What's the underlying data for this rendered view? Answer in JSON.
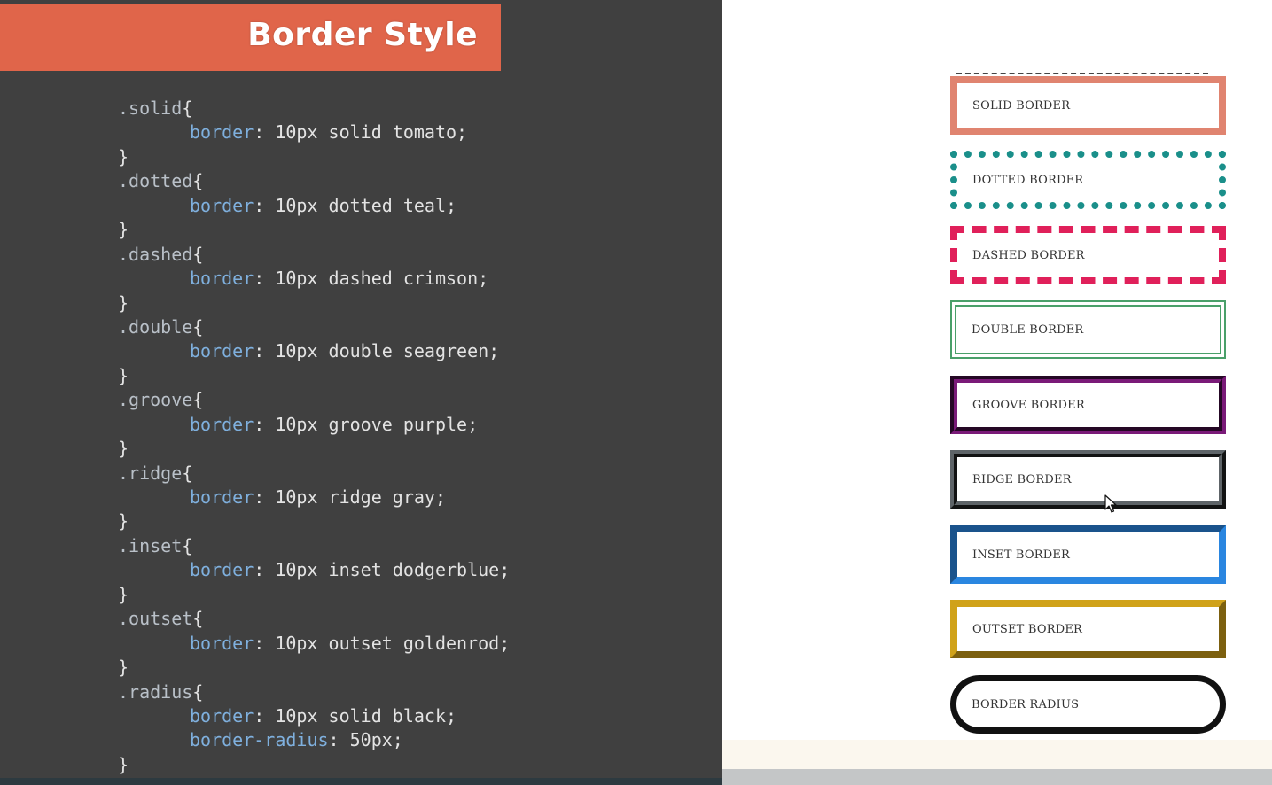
{
  "slide": {
    "title": "Border Style"
  },
  "code": {
    "lines": [
      {
        "selector": ".solid",
        "open": "{"
      },
      {
        "property": "border",
        "value": "10px solid tomato;"
      },
      {
        "close": "}"
      },
      {
        "selector": ".dotted",
        "open": "{"
      },
      {
        "property": "border",
        "value": "10px dotted teal;"
      },
      {
        "close": "}"
      },
      {
        "selector": ".dashed",
        "open": "{"
      },
      {
        "property": "border",
        "value": "10px dashed crimson;"
      },
      {
        "close": "}"
      },
      {
        "selector": ".double",
        "open": "{"
      },
      {
        "property": "border",
        "value": "10px double seagreen;"
      },
      {
        "close": "}"
      },
      {
        "selector": ".groove",
        "open": "{"
      },
      {
        "property": "border",
        "value": "10px groove purple;"
      },
      {
        "close": "}"
      },
      {
        "selector": ".ridge",
        "open": "{"
      },
      {
        "property": "border",
        "value": "10px ridge gray;"
      },
      {
        "close": "}"
      },
      {
        "selector": ".inset",
        "open": "{"
      },
      {
        "property": "border",
        "value": "10px inset dodgerblue;"
      },
      {
        "close": "}"
      },
      {
        "selector": ".outset",
        "open": "{"
      },
      {
        "property": "border",
        "value": "10px outset goldenrod;"
      },
      {
        "close": "}"
      },
      {
        "selector": ".radius",
        "open": "{"
      },
      {
        "property": "border",
        "value": "10px solid black;"
      },
      {
        "property": "border-radius",
        "value": "50px;"
      },
      {
        "close": "}"
      }
    ]
  },
  "preview": {
    "boxes": [
      {
        "id": "solid",
        "label": "SOLID BORDER"
      },
      {
        "id": "dotted",
        "label": "DOTTED BORDER"
      },
      {
        "id": "dashed",
        "label": "DASHED BORDER"
      },
      {
        "id": "double",
        "label": "DOUBLE BORDER"
      },
      {
        "id": "groove",
        "label": "GROOVE BORDER"
      },
      {
        "id": "ridge",
        "label": "RIDGE BORDER"
      },
      {
        "id": "inset",
        "label": "INSET BORDER"
      },
      {
        "id": "outset",
        "label": "OUTSET BORDER"
      },
      {
        "id": "radius",
        "label": "BORDER RADIUS"
      }
    ]
  },
  "colors": {
    "title_bar": "#e0654a",
    "code_background": "#404040",
    "tomato": "#e08470",
    "teal": "#1a8f8a",
    "crimson": "#e0205a",
    "seagreen": "#4aa06a",
    "purple": "#7a1a78",
    "gray": "#5e6468",
    "dodgerblue": "#2a86e0",
    "goldenrod": "#d0a21a",
    "black": "#111111"
  },
  "icons": {
    "cursor": "mouse-pointer-icon"
  }
}
